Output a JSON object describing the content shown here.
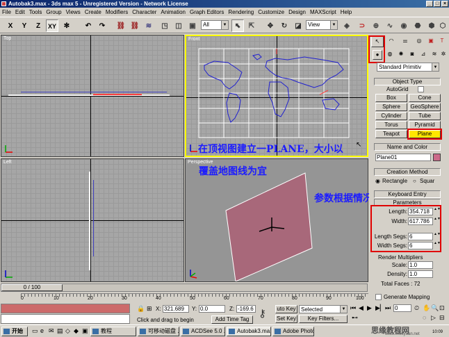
{
  "window": {
    "title": "Autobak3.max - 3ds max 5 - Unregistered Version - Network License"
  },
  "menu": [
    "File",
    "Edit",
    "Tools",
    "Group",
    "Views",
    "Create",
    "Modifiers",
    "Character",
    "Animation",
    "Graph Editors",
    "Rendering",
    "Customize",
    "Design",
    "MAXScript",
    "Help"
  ],
  "toolbar": {
    "axis_x": "X",
    "axis_y": "Y",
    "axis_z": "Z",
    "axis_xy": "XY",
    "filter_value": "All",
    "refcoord_value": "View"
  },
  "viewports": {
    "top": "Top",
    "front": "Front",
    "left": "Left",
    "perspective": "Perspective"
  },
  "annotations": {
    "line1": "在顶视图建立一PLANE，大小以",
    "line2": "覆盖地图线为宜",
    "line3": "参数根据情况而定"
  },
  "command_panel": {
    "category_value": "Standard Primitiv",
    "object_type_title": "Object Type",
    "autogrid": "AutoGrid",
    "buttons": [
      "Box",
      "Cone",
      "Sphere",
      "GeoSphere",
      "Cylinder",
      "Tube",
      "Torus",
      "Pyramid",
      "Teapot",
      "Plane"
    ],
    "name_color_title": "Name and Color",
    "object_name": "Plane01",
    "object_color": "#cc6a8a",
    "creation_method_title": "Creation Method",
    "method_rect": "Rectangle",
    "method_square": "Squar",
    "keyboard_entry_title": "Keyboard Entry",
    "parameters_title": "Parameters",
    "length_label": "Length:",
    "length_value": "354.718",
    "width_label": "Width:",
    "width_value": "617.786",
    "length_segs_label": "Length Segs:",
    "length_segs_value": "6",
    "width_segs_label": "Width Segs:",
    "width_segs_value": "6",
    "render_mult_title": "Render Multipliers",
    "scale_label": "Scale:",
    "scale_value": "1.0",
    "density_label": "Density:",
    "density_value": "1.0",
    "total_faces": "Total Faces : 72",
    "generate_mapping": "Generate Mapping"
  },
  "timeline": {
    "frame_counter": "0 / 100",
    "ticks": [
      "0",
      "10",
      "20",
      "30",
      "40",
      "50",
      "60",
      "70",
      "80",
      "90",
      "100"
    ]
  },
  "status": {
    "x_label": "X:",
    "x_value": "321.689",
    "y_label": "Y:",
    "y_value": "0.0",
    "z_label": "Z:",
    "z_value": "-169.6",
    "prompt": "Click and drag to begin",
    "add_time_tag": "Add Time Tag",
    "auto_key": "uto Key",
    "selected": "Selected",
    "set_key": "Set Key",
    "key_filters": "Key Filters...",
    "frame_field": "0"
  },
  "taskbar": {
    "start": "开始",
    "tasks": [
      "教程",
      "可移动磁盘 ...",
      "ACDSee 5.0 ...",
      "Autobak3.ma...",
      "Adobe Photo..."
    ],
    "watermark": "思缘教程网",
    "watermark_url": "www.missyuan.net",
    "clock": "10:09"
  }
}
